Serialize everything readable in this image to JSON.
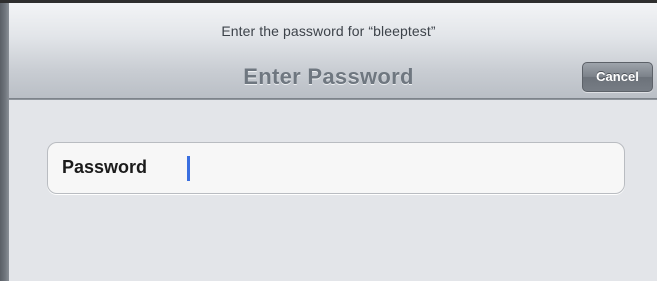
{
  "dialog": {
    "prompt": "Enter the password for “bleeptest”",
    "title": "Enter Password",
    "cancel_label": "Cancel"
  },
  "password_field": {
    "label": "Password",
    "value": "",
    "placeholder": ""
  },
  "colors": {
    "caret": "#3a6fe0",
    "background": "#e3e5e9"
  }
}
